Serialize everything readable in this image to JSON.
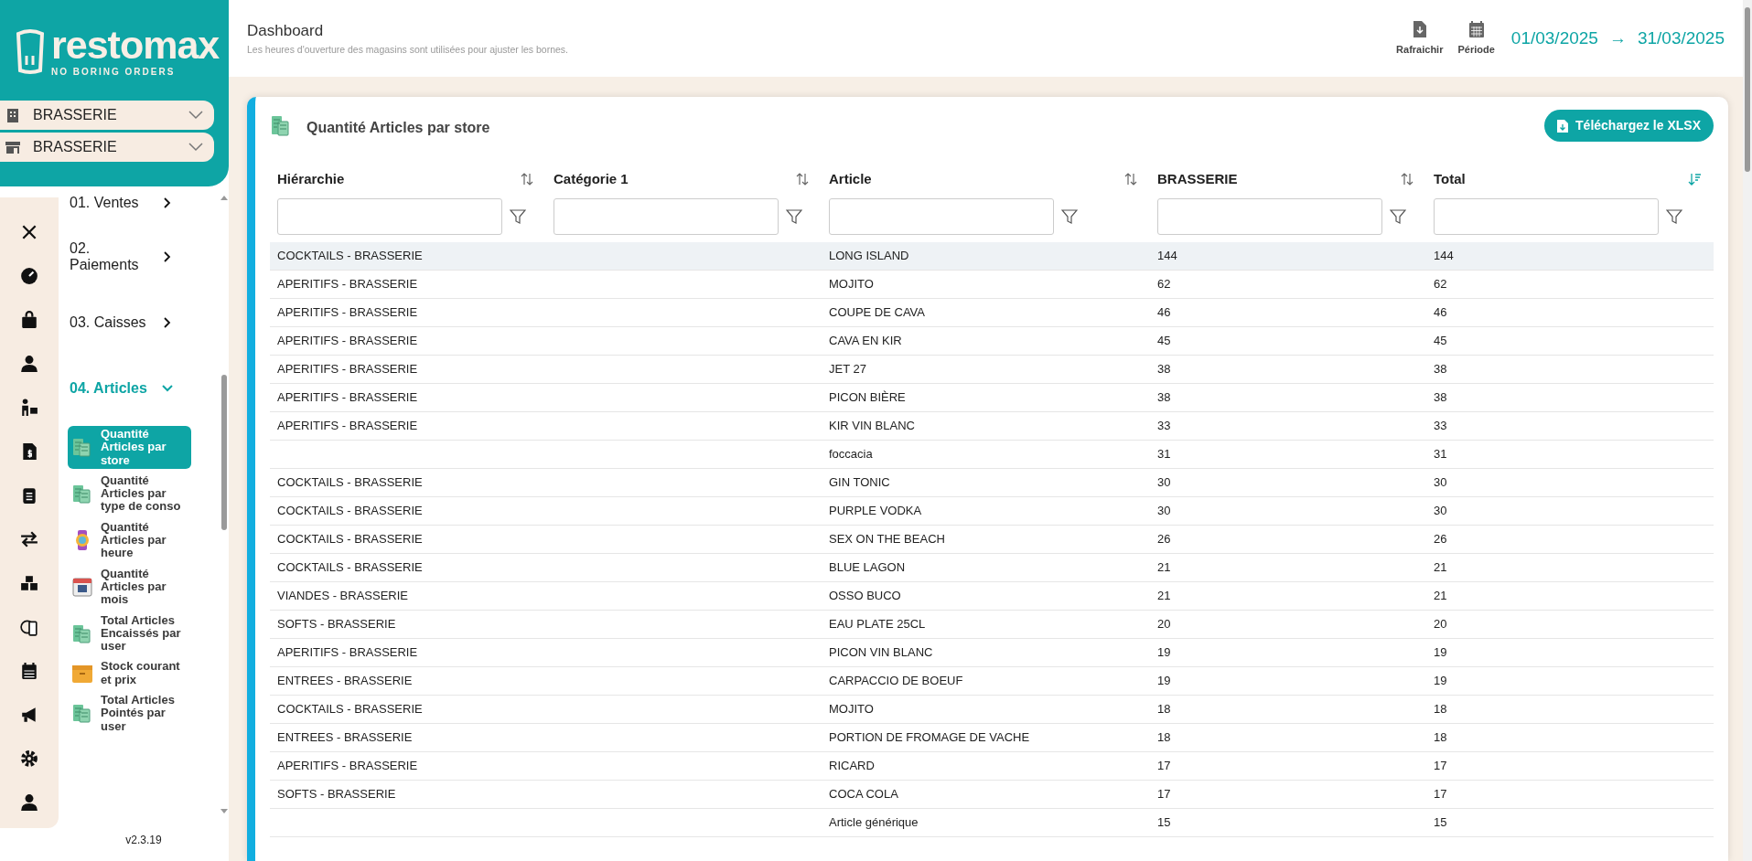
{
  "brand": {
    "name": "restomax",
    "tagline": "NO BORING ORDERS"
  },
  "selectors": [
    {
      "kind": "building",
      "label": "BRASSERIE"
    },
    {
      "kind": "store",
      "label": "BRASSERIE"
    }
  ],
  "menu": [
    {
      "label": "01. Ventes",
      "expanded": false
    },
    {
      "label": "02. Paiements",
      "expanded": false
    },
    {
      "label": "03. Caisses",
      "expanded": false
    },
    {
      "label": "04. Articles",
      "expanded": true,
      "children": [
        {
          "label": "Quantité Articles par store",
          "kind": "money",
          "selected": true
        },
        {
          "label": "Quantité Articles par type de conso",
          "kind": "money",
          "selected": false
        },
        {
          "label": "Quantité Articles par heure",
          "kind": "watch",
          "selected": false
        },
        {
          "label": "Quantité Articles par mois",
          "kind": "calendar",
          "selected": false
        },
        {
          "label": "Total Articles Encaissés par user",
          "kind": "money",
          "selected": false
        },
        {
          "label": "Stock courant et prix",
          "kind": "box",
          "selected": false
        },
        {
          "label": "Total Articles Pointés par user",
          "kind": "money",
          "selected": false
        }
      ]
    }
  ],
  "version": "v2.3.19",
  "header": {
    "title": "Dashboard",
    "subtitle": "Les heures d'ouverture des magasins sont utilisées pour ajuster les bornes.",
    "actions": [
      {
        "kind": "refresh",
        "label": "Rafraichir"
      },
      {
        "kind": "period",
        "label": "Période"
      }
    ],
    "date_from": "01/03/2025",
    "arrow": "→",
    "date_to": "31/03/2025"
  },
  "card": {
    "title": "Quantité Articles par store",
    "download": "Téléchargez le XLSX",
    "columns": [
      {
        "label": "Hiérarchie",
        "sorted": false
      },
      {
        "label": "Catégorie 1",
        "sorted": false
      },
      {
        "label": "Article",
        "sorted": false
      },
      {
        "label": "BRASSERIE",
        "sorted": false
      },
      {
        "label": "Total",
        "sorted": true
      }
    ],
    "rows": [
      {
        "selected": true,
        "cells": [
          "COCKTAILS - BRASSERIE",
          null,
          "LONG ISLAND",
          "144",
          "144"
        ]
      },
      {
        "selected": false,
        "cells": [
          "APERITIFS - BRASSERIE",
          null,
          "MOJITO",
          "62",
          "62"
        ]
      },
      {
        "selected": false,
        "cells": [
          "APERITIFS - BRASSERIE",
          null,
          "COUPE DE CAVA",
          "46",
          "46"
        ]
      },
      {
        "selected": false,
        "cells": [
          "APERITIFS - BRASSERIE",
          null,
          "CAVA EN KIR",
          "45",
          "45"
        ]
      },
      {
        "selected": false,
        "cells": [
          "APERITIFS - BRASSERIE",
          null,
          "JET 27",
          "38",
          "38"
        ]
      },
      {
        "selected": false,
        "cells": [
          "APERITIFS - BRASSERIE",
          null,
          "PICON BIÈRE",
          "38",
          "38"
        ]
      },
      {
        "selected": false,
        "cells": [
          "APERITIFS - BRASSERIE",
          null,
          "KIR VIN BLANC",
          "33",
          "33"
        ]
      },
      {
        "selected": false,
        "cells": [
          null,
          null,
          "foccacia",
          "31",
          "31"
        ]
      },
      {
        "selected": false,
        "cells": [
          "COCKTAILS - BRASSERIE",
          null,
          "GIN TONIC",
          "30",
          "30"
        ]
      },
      {
        "selected": false,
        "cells": [
          "COCKTAILS - BRASSERIE",
          null,
          "PURPLE VODKA",
          "30",
          "30"
        ]
      },
      {
        "selected": false,
        "cells": [
          "COCKTAILS - BRASSERIE",
          null,
          "SEX ON THE BEACH",
          "26",
          "26"
        ]
      },
      {
        "selected": false,
        "cells": [
          "COCKTAILS - BRASSERIE",
          null,
          "BLUE LAGON",
          "21",
          "21"
        ]
      },
      {
        "selected": false,
        "cells": [
          "VIANDES - BRASSERIE",
          null,
          "OSSO BUCO",
          "21",
          "21"
        ]
      },
      {
        "selected": false,
        "cells": [
          "SOFTS - BRASSERIE",
          null,
          "EAU PLATE 25CL",
          "20",
          "20"
        ]
      },
      {
        "selected": false,
        "cells": [
          "APERITIFS - BRASSERIE",
          null,
          "PICON VIN BLANC",
          "19",
          "19"
        ]
      },
      {
        "selected": false,
        "cells": [
          "ENTREES - BRASSERIE",
          null,
          "CARPACCIO DE BOEUF",
          "19",
          "19"
        ]
      },
      {
        "selected": false,
        "cells": [
          "COCKTAILS - BRASSERIE",
          null,
          "MOJITO",
          "18",
          "18"
        ]
      },
      {
        "selected": false,
        "cells": [
          "ENTREES - BRASSERIE",
          null,
          "PORTION DE FROMAGE DE VACHE",
          "18",
          "18"
        ]
      },
      {
        "selected": false,
        "cells": [
          "APERITIFS - BRASSERIE",
          null,
          "RICARD",
          "17",
          "17"
        ]
      },
      {
        "selected": false,
        "cells": [
          "SOFTS - BRASSERIE",
          null,
          "COCA COLA",
          "17",
          "17"
        ]
      },
      {
        "selected": false,
        "cells": [
          null,
          null,
          "Article générique",
          "15",
          "15"
        ]
      }
    ]
  }
}
